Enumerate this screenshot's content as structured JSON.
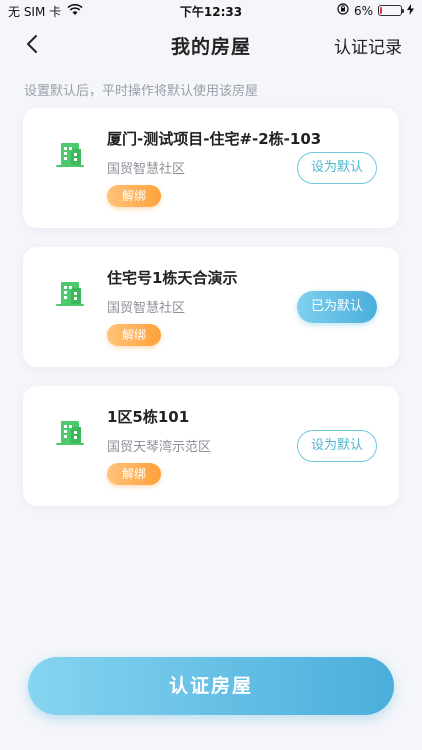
{
  "status_bar": {
    "carrier": "无 SIM 卡",
    "time": "下午12:33",
    "battery_percent": "6%",
    "battery_level": 0.06
  },
  "navbar": {
    "title": "我的房屋",
    "right_action": "认证记录"
  },
  "hint": "设置默认后，平时操作将默认使用该房屋",
  "houses": [
    {
      "name": "厦门-测试项目-住宅#-2栋-103",
      "community": "国贸智慧社区",
      "unbind_label": "解绑",
      "default_label": "设为默认",
      "is_default": false
    },
    {
      "name": "住宅号1栋天合演示",
      "community": "国贸智慧社区",
      "unbind_label": "解绑",
      "default_label": "已为默认",
      "is_default": true
    },
    {
      "name": "1区5栋101",
      "community": "国贸天琴湾示范区",
      "unbind_label": "解绑",
      "default_label": "设为默认",
      "is_default": false
    }
  ],
  "certify_button": "认证房屋",
  "colors": {
    "accent": "#4aaedb",
    "unbind": "#ffa13a",
    "building_icon": "#4cc96b"
  }
}
